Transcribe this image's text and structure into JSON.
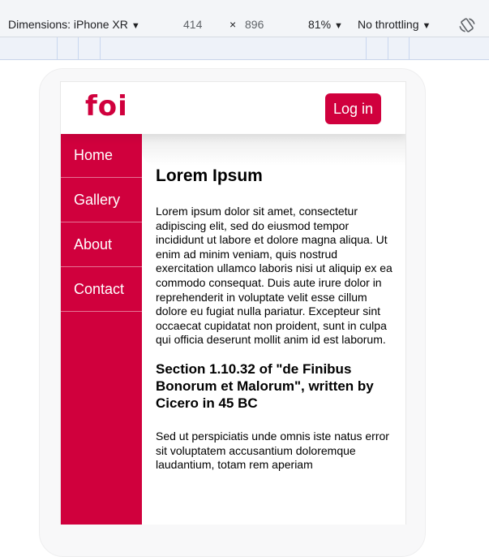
{
  "devtools": {
    "dimensions_label": "Dimensions: iPhone XR",
    "width": "414",
    "times": "×",
    "height": "896",
    "zoom": "81%",
    "throttling": "No throttling",
    "caret": "▼"
  },
  "site": {
    "logo": "foi",
    "login_label": "Log in",
    "brand_color": "#d0003d",
    "nav": [
      {
        "label": "Home"
      },
      {
        "label": "Gallery"
      },
      {
        "label": "About"
      },
      {
        "label": "Contact"
      }
    ],
    "content": {
      "title": "Lorem Ipsum",
      "paragraph1": "Lorem ipsum dolor sit amet, consectetur adipiscing elit, sed do eiusmod tempor incididunt ut labore et dolore magna aliqua. Ut enim ad minim veniam, quis nostrud exercitation ullamco laboris nisi ut aliquip ex ea commodo consequat. Duis aute irure dolor in reprehenderit in voluptate velit esse cillum dolore eu fugiat nulla pariatur. Excepteur sint occaecat cupidatat non proident, sunt in culpa qui officia deserunt mollit anim id est laborum.",
      "section_title": "Section 1.10.32 of \"de Finibus Bonorum et Malorum\", written by Cicero in 45 BC",
      "paragraph2": "Sed ut perspiciatis unde omnis iste natus error sit voluptatem accusantium doloremque laudantium, totam rem aperiam"
    }
  }
}
